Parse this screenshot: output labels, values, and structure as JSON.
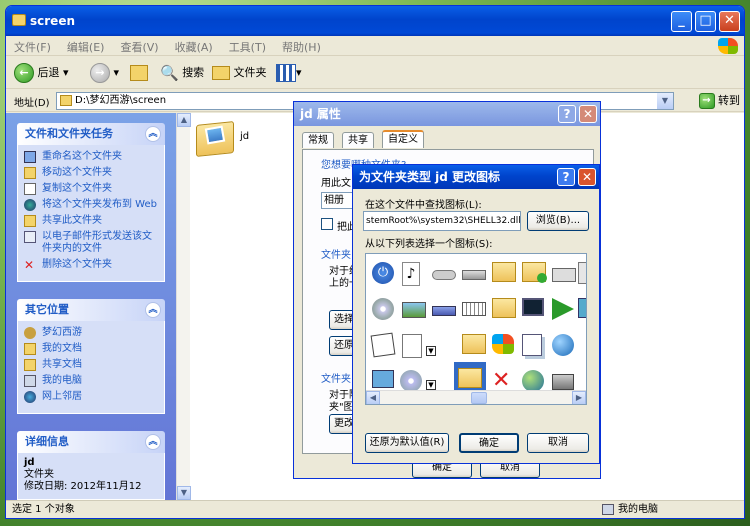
{
  "window": {
    "title": "screen"
  },
  "menu": [
    "文件(F)",
    "编辑(E)",
    "查看(V)",
    "收藏(A)",
    "工具(T)",
    "帮助(H)"
  ],
  "toolbar": {
    "back": "后退",
    "search": "搜索",
    "folders": "文件夹"
  },
  "address": {
    "label": "地址(D)",
    "value": "D:\\梦幻西游\\screen",
    "go": "转到"
  },
  "file_tasks": {
    "title": "文件和文件夹任务",
    "items": [
      "重命名这个文件夹",
      "移动这个文件夹",
      "复制这个文件夹",
      "将这个文件夹发布到 Web",
      "共享此文件夹",
      "以电子邮件形式发送该文件夹内的文件",
      "删除这个文件夹"
    ]
  },
  "other_places": {
    "title": "其它位置",
    "items": [
      "梦幻西游",
      "我的文档",
      "共享文档",
      "我的电脑",
      "网上邻居"
    ]
  },
  "details": {
    "title": "详细信息",
    "name": "jd",
    "type": "文件夹",
    "modified": "修改日期: 2012年11月12"
  },
  "folder_item": {
    "name": "jd"
  },
  "status": {
    "left": "选定 1 个对象",
    "right": "我的电脑"
  },
  "props": {
    "title": "jd 属性",
    "tabs": [
      "常规",
      "共享",
      "自定义"
    ],
    "text1": "您想要哪种文件夹?",
    "text2": "用此文",
    "select_value": "相册",
    "checkbox_label": "把此",
    "section2": "文件夹",
    "text3": "对于缩",
    "text4": "上的一",
    "btn_choose": "选择图",
    "btn_restore": "还原默",
    "section3": "文件夹",
    "text5": "对于除",
    "text6": "夹\"图",
    "btn_change": "更改图",
    "bottom_ok": "确定",
    "bottom_cancel": "取消"
  },
  "icondlg": {
    "title": "为文件夹类型 jd 更改图标",
    "look_label": "在这个文件中查找图标(L):",
    "file_path": "stemRoot%\\system32\\SHELL32.dll",
    "browse": "浏览(B)...",
    "select_label": "从以下列表选择一个图标(S):",
    "restore": "还原为默认值(R)",
    "ok": "确定",
    "cancel": "取消"
  },
  "colors": {
    "xp_blue": "#0a5fe8",
    "panel_link": "#215dc6"
  }
}
